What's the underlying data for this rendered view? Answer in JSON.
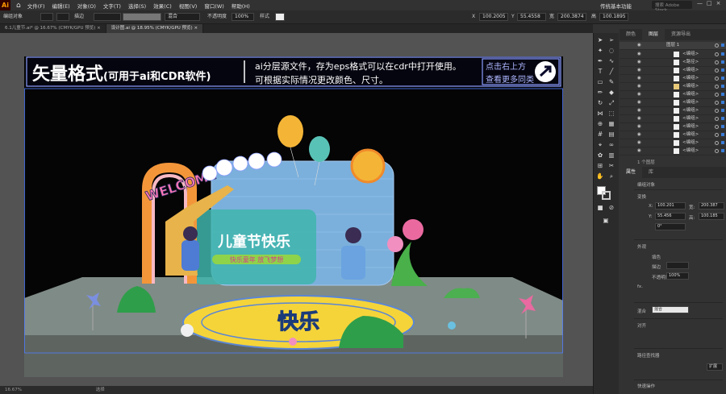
{
  "app": {
    "logo": "Ai",
    "workspace": "传统基本功能",
    "search_placeholder": "搜索 Adobe Stock"
  },
  "menu": [
    "文件(F)",
    "编辑(E)",
    "对象(O)",
    "文字(T)",
    "选择(S)",
    "效果(C)",
    "视图(V)",
    "窗口(W)",
    "帮助(H)"
  ],
  "control_bar": {
    "selection": "编组对象",
    "stroke_label": "描边",
    "blend": "混合",
    "opacity_label": "不透明度",
    "opacity": "100%",
    "style_label": "样式",
    "x_label": "X",
    "x": "100.2005",
    "y_label": "Y",
    "y": "55.4558",
    "w_label": "宽",
    "w": "200.3874",
    "h_label": "高",
    "h": "100.1895"
  },
  "tabs": [
    {
      "label": "6.1儿童节.ai* @ 16.67% (CMYK/GPU 预览)",
      "close": "×"
    },
    {
      "label": "设计图.ai @ 18.95% (CMYK/GPU 预览)",
      "close": "×"
    }
  ],
  "banner": {
    "title": "矢量格式",
    "title_sub": "(可用于ai和CDR软件)",
    "line1": "ai分层源文件，存为eps格式可以在cdr中打开使用。",
    "line2": "可根据实际情况更改颜色、尺寸。",
    "cta1": "点击右上方",
    "cta2": "查看更多同类"
  },
  "artwork": {
    "welcome": "WELCOME",
    "sign_title": "儿童节快乐",
    "sign_sub": "快乐童年 放飞梦想",
    "floor_text": "快乐",
    "logo_mark": "Ai"
  },
  "statusbar": {
    "zoom": "16.67%",
    "mode": "选择"
  },
  "colors": {
    "accent": "#3a7bd5",
    "banner_border": "#8a9cff",
    "banner_text": "#ffffff",
    "cta_text": "#aeb8ff"
  },
  "layers_panel": {
    "tabs": [
      "颜色",
      "图层",
      "资源导出"
    ],
    "active_tab": "图层",
    "top_layer": "图层 1",
    "rows": [
      "<编组>",
      "<路径>",
      "<编组>",
      "<编组>",
      "<编组>",
      "<编组>",
      "<编组>",
      "<编组>",
      "<编组>",
      "<编组>",
      "<编组>",
      "<编组>",
      "<编组>"
    ],
    "footer": "1 个图层"
  },
  "properties_panel": {
    "tabs": [
      "属性",
      "库"
    ],
    "active_tab": "属性",
    "object_type": "编组对象",
    "transform_label": "变换",
    "x_label": "X:",
    "x": "100.201",
    "y_label": "Y:",
    "y": "55.456",
    "w_label": "宽:",
    "w": "200.387",
    "h_label": "高:",
    "h": "100.185",
    "angle": "0°",
    "appearance_label": "外观",
    "fill_label": "填色",
    "stroke_label": "描边",
    "opacity_label": "不透明度",
    "opacity": "100%",
    "fx": "fx.",
    "blend_label": "混合",
    "blend_value": "混合",
    "align_label": "对齐",
    "pathfinder_label": "路径查找器",
    "expand_label": "扩展",
    "quick_actions": "快速操作"
  },
  "tools": [
    "select-icon",
    "direct-select-icon",
    "magic-wand-icon",
    "lasso-icon",
    "pen-icon",
    "curvature-icon",
    "type-icon",
    "line-icon",
    "rectangle-icon",
    "brush-icon",
    "pencil-icon",
    "eraser-icon",
    "rotate-icon",
    "scale-icon",
    "width-icon",
    "free-transform-icon",
    "shape-builder-icon",
    "perspective-icon",
    "mesh-icon",
    "gradient-icon",
    "eyedropper-icon",
    "blend-icon",
    "symbol-icon",
    "graph-icon",
    "artboard-icon",
    "slice-icon",
    "hand-icon",
    "zoom-icon"
  ]
}
